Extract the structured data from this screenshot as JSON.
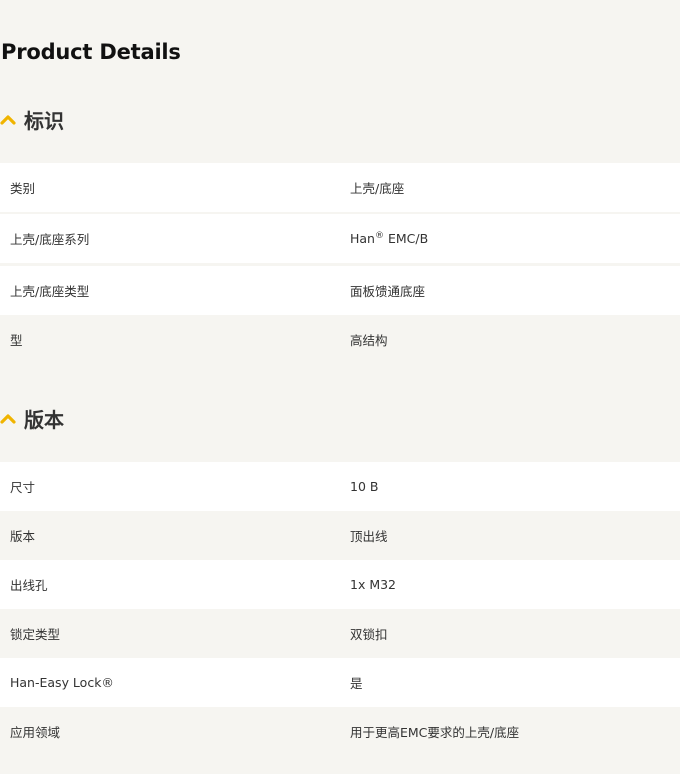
{
  "page": {
    "title": "Product Details",
    "accent_color": "#f0b400"
  },
  "sections": [
    {
      "title": "标识",
      "icon": "chevron-up-icon",
      "rows": [
        {
          "label": "类别",
          "value": "上壳/底座"
        },
        {
          "label": "上壳/底座系列",
          "value_prefix": "Han",
          "value_sup": "®",
          "value_suffix": " EMC/B"
        },
        {
          "label": "上壳/底座类型",
          "value": "面板馈通底座"
        },
        {
          "label": "型",
          "value": "高结构"
        }
      ]
    },
    {
      "title": "版本",
      "icon": "chevron-up-icon",
      "rows": [
        {
          "label": "尺寸",
          "value": "10 B"
        },
        {
          "label": "版本",
          "value": "顶出线"
        },
        {
          "label": "出线孔",
          "value": "1x M32"
        },
        {
          "label": "锁定类型",
          "value": "双锁扣"
        },
        {
          "label": "Han-Easy Lock®",
          "value": "是"
        },
        {
          "label": "应用领域",
          "value": "用于更高EMC要求的上壳/底座"
        }
      ]
    }
  ]
}
